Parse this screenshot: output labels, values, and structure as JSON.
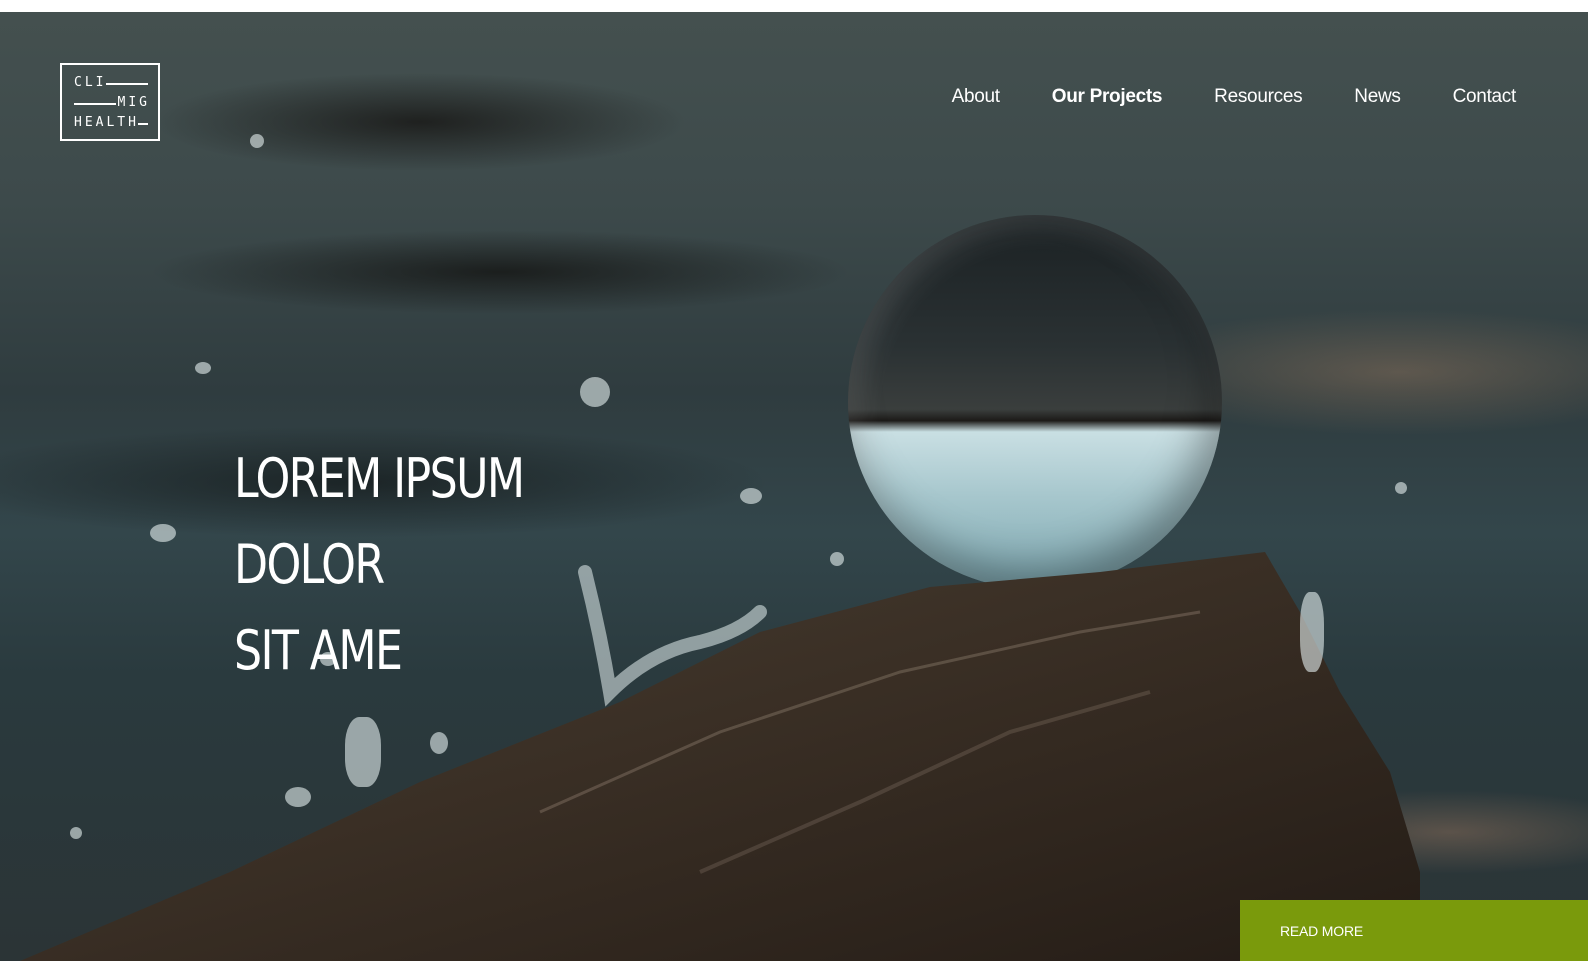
{
  "logo": {
    "line1": "CLI",
    "line2": "MIG",
    "line3": "HEALTH"
  },
  "nav": {
    "items": [
      {
        "label": "About",
        "active": false
      },
      {
        "label": "Our Projects",
        "active": true
      },
      {
        "label": "Resources",
        "active": false
      },
      {
        "label": "News",
        "active": false
      },
      {
        "label": "Contact",
        "active": false
      }
    ]
  },
  "hero": {
    "headline_line1": "LOREM IPSUM DOLOR",
    "headline_line2": "SIT AME",
    "cta_label": "READ MORE"
  },
  "colors": {
    "cta_background": "#7a9a0c",
    "text": "#ffffff"
  }
}
